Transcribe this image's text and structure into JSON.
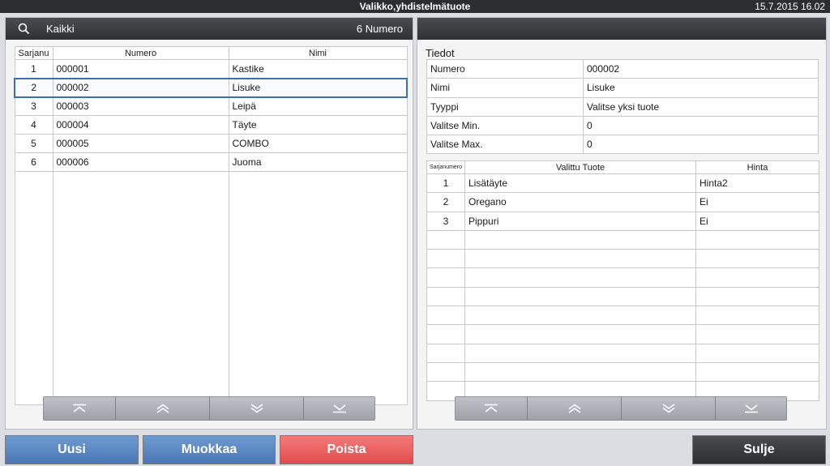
{
  "titlebar": {
    "title": "Valikko,yhdistelmätuote",
    "datetime": "15.7.2015 16.02"
  },
  "left": {
    "filter": "Kaikki",
    "count": "6",
    "sort_label": "Numero",
    "columns": [
      "Sarjanu",
      "Numero",
      "Nimi"
    ],
    "rows": [
      {
        "seq": "1",
        "number": "000001",
        "name": "Kastike"
      },
      {
        "seq": "2",
        "number": "000002",
        "name": "Lisuke"
      },
      {
        "seq": "3",
        "number": "000003",
        "name": "Leipä"
      },
      {
        "seq": "4",
        "number": "000004",
        "name": "Täyte"
      },
      {
        "seq": "5",
        "number": "000005",
        "name": "COMBO"
      },
      {
        "seq": "6",
        "number": "000006",
        "name": "Juoma"
      }
    ],
    "selected_row": 2
  },
  "right": {
    "section_title": "Tiedot",
    "details": [
      {
        "key": "Numero",
        "value": "000002"
      },
      {
        "key": "Nimi",
        "value": "Lisuke"
      },
      {
        "key": "Tyyppi",
        "value": "Valitse yksi tuote"
      },
      {
        "key": "Valitse Min.",
        "value": "0"
      },
      {
        "key": "Valitse Max.",
        "value": "0"
      }
    ],
    "columns": [
      "Sarjanumero",
      "Valittu Tuote",
      "Hinta"
    ],
    "items": [
      {
        "seq": "1",
        "product": "Lisätäyte",
        "price": "Hinta2"
      },
      {
        "seq": "2",
        "product": "Oregano",
        "price": "Ei"
      },
      {
        "seq": "3",
        "product": "Pippuri",
        "price": "Ei"
      }
    ]
  },
  "buttons": {
    "new": "Uusi",
    "edit": "Muokkaa",
    "delete": "Poista",
    "close": "Sulje"
  },
  "colors": {
    "accent_blue": "#4a77b4",
    "danger_red": "#e04c4c",
    "dark": "#2b2d30",
    "selection": "#3a6fb0"
  }
}
